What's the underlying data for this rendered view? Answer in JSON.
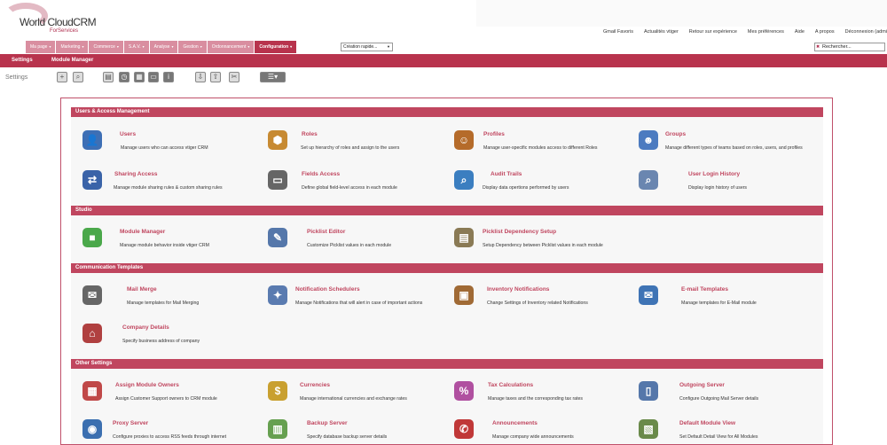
{
  "logo": {
    "title": "World CloudCRM",
    "sub": "ForServices"
  },
  "top_links": [
    "Gmail Favoris",
    "Actualités vtiger",
    "Retour sur expérience",
    "Mes préférences",
    "Aide",
    "A propos",
    "Déconnexion (admi"
  ],
  "nav_tabs": [
    {
      "label": "Ma page",
      "caret": "▾"
    },
    {
      "label": "Marketing",
      "caret": "▾"
    },
    {
      "label": "Commerce",
      "caret": "▾"
    },
    {
      "label": "S.A.V.",
      "caret": "▾"
    },
    {
      "label": "Analyse",
      "caret": "▾"
    },
    {
      "label": "Gestion",
      "caret": "▾"
    },
    {
      "label": "Ordonnancement",
      "caret": "▾"
    },
    {
      "label": "Configuration",
      "caret": "▾"
    }
  ],
  "quick_create": "Création rapide...",
  "search_placeholder": "Rechercher...",
  "subnav": {
    "settings": "Settings",
    "module_manager": "Module Manager"
  },
  "settings_label": "Settings",
  "sections": {
    "users": "Users & Access Management",
    "studio": "Studio",
    "comm": "Communication Templates",
    "other": "Other Settings"
  },
  "items": [
    {
      "title": "Users",
      "desc": "Manage users who can access vtiger CRM",
      "icon": "users-icon",
      "color": "#3d6fb5"
    },
    {
      "title": "Roles",
      "desc": "Set up hierarchy of roles and assign to the users",
      "icon": "roles-icon",
      "color": "#c78a32"
    },
    {
      "title": "Profiles",
      "desc": "Manage user-specific modules access to different Roles",
      "icon": "profiles-icon",
      "color": "#b56b2a"
    },
    {
      "title": "Groups",
      "desc": "Manage different types of teams based on roles, users, and profiles",
      "icon": "groups-icon",
      "color": "#4c7bc0"
    },
    {
      "title": "Sharing Access",
      "desc": "Manage module sharing rules & custom sharing rules",
      "icon": "sharing-access-icon",
      "color": "#3a63a8"
    },
    {
      "title": "Fields Access",
      "desc": "Define global field-level access in each module",
      "icon": "fields-access-icon",
      "color": "#666666"
    },
    {
      "title": "Audit Trails",
      "desc": "Display data opertions performed by users",
      "icon": "audit-trails-icon",
      "color": "#3b7ec0"
    },
    {
      "title": "User Login History",
      "desc": "Display login history of users",
      "icon": "login-history-icon",
      "color": "#6a86b0"
    },
    {
      "title": "Module Manager",
      "desc": "Manage module behavior inside vtiger CRM",
      "icon": "module-manager-icon",
      "color": "#4aa84a"
    },
    {
      "title": "Picklist Editor",
      "desc": "Customize Picklist values in each module",
      "icon": "picklist-editor-icon",
      "color": "#5577aa"
    },
    {
      "title": "Picklist Dependency Setup",
      "desc": "Setup Dependency between Picklist values in each module",
      "icon": "picklist-dependency-icon",
      "color": "#8a7a55"
    },
    {
      "title": "Mail Merge",
      "desc": "Manage templates for Mail Merging",
      "icon": "mail-merge-icon",
      "color": "#666666"
    },
    {
      "title": "Notification Schedulers",
      "desc": "Manage Notifications that will alert in case of important actions",
      "icon": "notification-icon",
      "color": "#5a7bb0"
    },
    {
      "title": "Inventory Notifications",
      "desc": "Change Settings of Inventory related Notifications",
      "icon": "inventory-icon",
      "color": "#a06a35"
    },
    {
      "title": "E-mail Templates",
      "desc": "Manage templates for E-Mail module",
      "icon": "email-templates-icon",
      "color": "#3f74b5"
    },
    {
      "title": "Company Details",
      "desc": "Specify business address of company",
      "icon": "company-icon",
      "color": "#b04040"
    },
    {
      "title": "Assign Module Owners",
      "desc": "Assign Customer Support owners to CRM module",
      "icon": "module-owners-icon",
      "color": "#c04848"
    },
    {
      "title": "Currencies",
      "desc": "Manage international currencies and exchange rates",
      "icon": "currencies-icon",
      "color": "#c9a030"
    },
    {
      "title": "Tax Calculations",
      "desc": "Manage taxes and the corresponding tax rates",
      "icon": "tax-icon",
      "color": "#b050a0"
    },
    {
      "title": "Outgoing Server",
      "desc": "Configure Outgoing Mail Server details",
      "icon": "outgoing-server-icon",
      "color": "#5577aa"
    },
    {
      "title": "Proxy Server",
      "desc": "Configure proxies to access RSS feeds through internet",
      "icon": "proxy-server-icon",
      "color": "#3b6fb0"
    },
    {
      "title": "Backup Server",
      "desc": "Specify database backup server details",
      "icon": "backup-server-icon",
      "color": "#66a050"
    },
    {
      "title": "Announcements",
      "desc": "Manage company wide announcements",
      "icon": "announcements-icon",
      "color": "#c03838"
    },
    {
      "title": "Default Module View",
      "desc": "Set Default Detail View for All Modules",
      "icon": "default-view-icon",
      "color": "#6a8a4a"
    }
  ]
}
